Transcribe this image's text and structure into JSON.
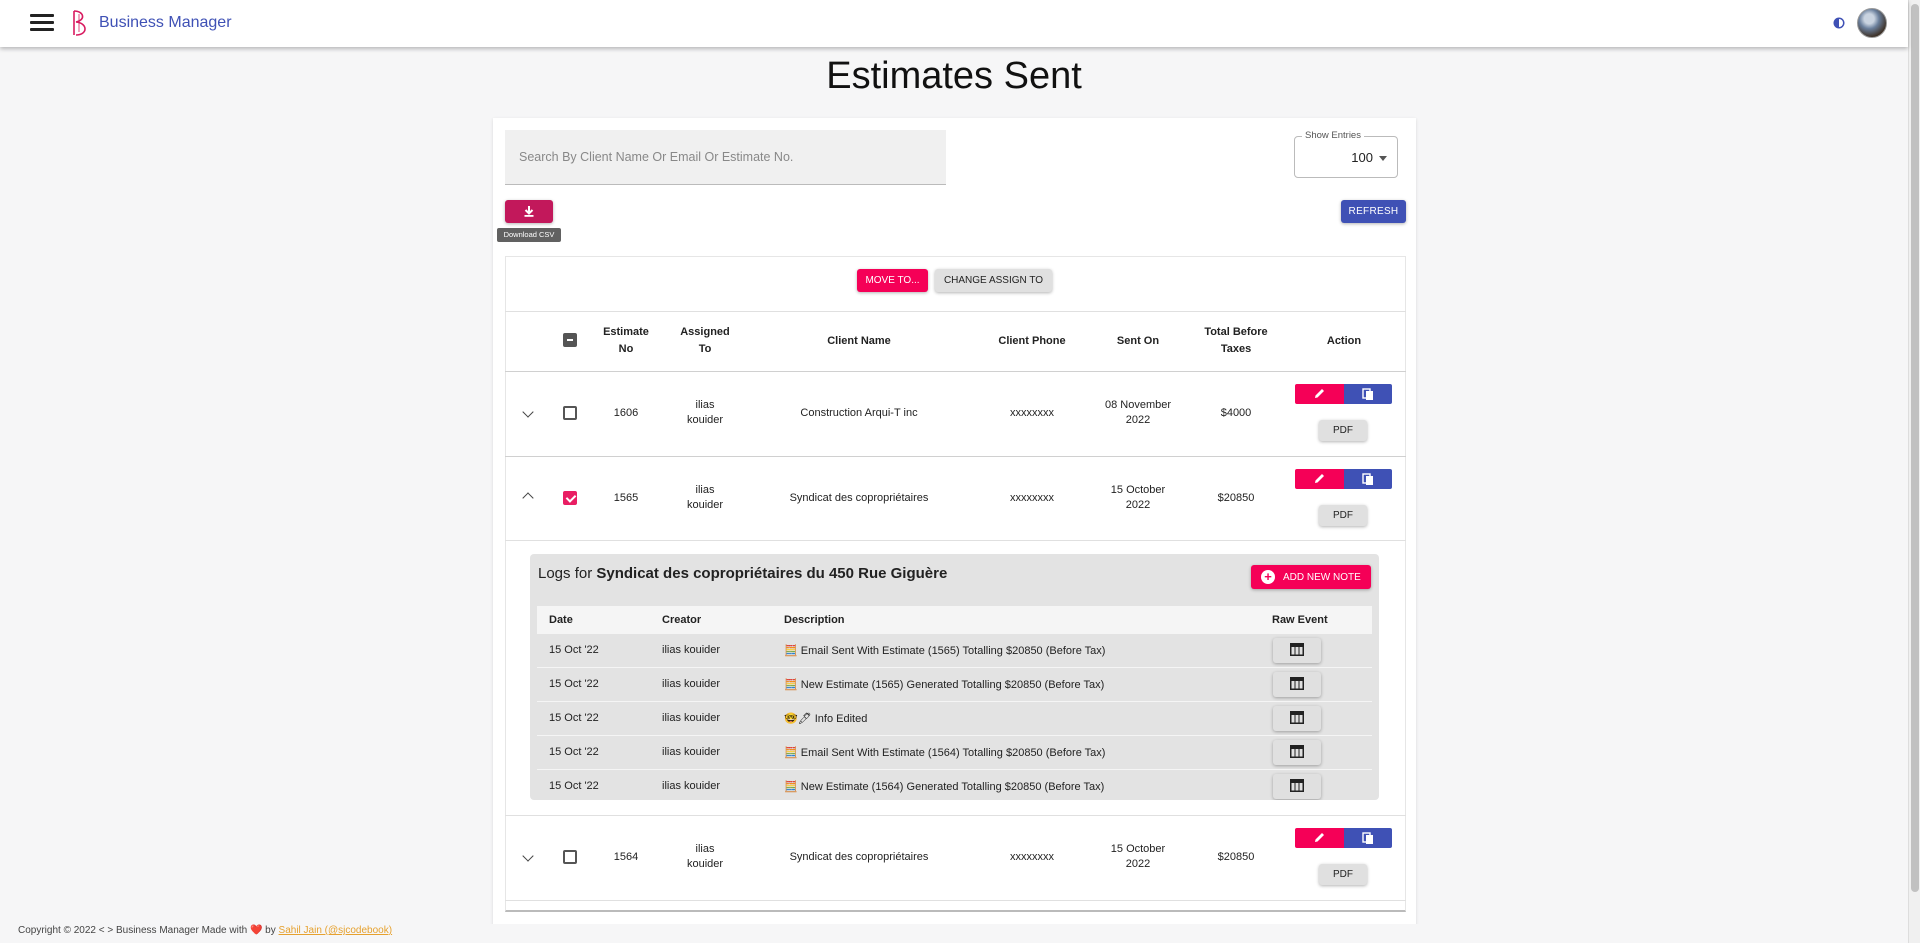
{
  "app": {
    "title": "Business Manager"
  },
  "page": {
    "title": "Estimates Sent"
  },
  "search": {
    "placeholder": "Search By Client Name Or Email Or Estimate No.",
    "value": ""
  },
  "entries": {
    "label": "Show Entries",
    "value": "100"
  },
  "toolbar": {
    "download_tooltip": "Download CSV",
    "refresh_label": "REFRESH",
    "move_label": "MOVE TO...",
    "assign_label": "CHANGE ASSIGN TO"
  },
  "table": {
    "headers": {
      "estimate_no_1": "Estimate",
      "estimate_no_2": "No",
      "assigned_1": "Assigned",
      "assigned_2": "To",
      "client_name": "Client Name",
      "client_phone": "Client Phone",
      "sent_on": "Sent On",
      "total_1": "Total Before",
      "total_2": "Taxes",
      "action": "Action"
    },
    "rows": [
      {
        "estimate_no": "1606",
        "assigned_1": "ilias",
        "assigned_2": "kouider",
        "client_name": "Construction Arqui-T inc",
        "phone": "xxxxxxxx",
        "sent_1": "08 November",
        "sent_2": "2022",
        "total": "$4000",
        "pdf": "PDF",
        "checked": false
      },
      {
        "estimate_no": "1565",
        "assigned_1": "ilias",
        "assigned_2": "kouider",
        "client_name": "Syndicat des copropriétaires",
        "phone": "xxxxxxxx",
        "sent_1": "15 October",
        "sent_2": "2022",
        "total": "$20850",
        "pdf": "PDF",
        "checked": true
      },
      {
        "estimate_no": "1564",
        "assigned_1": "ilias",
        "assigned_2": "kouider",
        "client_name": "Syndicat des copropriétaires",
        "phone": "xxxxxxxx",
        "sent_1": "15 October",
        "sent_2": "2022",
        "total": "$20850",
        "pdf": "PDF",
        "checked": false
      }
    ]
  },
  "logs": {
    "title_prefix": "Logs for ",
    "title_client": "Syndicat des copropriétaires du 450 Rue Giguère",
    "add_note_label": "ADD NEW NOTE",
    "headers": {
      "date": "Date",
      "creator": "Creator",
      "description": "Description",
      "raw": "Raw Event"
    },
    "rows": [
      {
        "date": "15 Oct '22",
        "creator": "ilias kouider",
        "description": "🧮 Email Sent With Estimate (1565) Totalling $20850 (Before Tax)"
      },
      {
        "date": "15 Oct '22",
        "creator": "ilias kouider",
        "description": "🧮 New Estimate (1565) Generated Totalling $20850 (Before Tax)"
      },
      {
        "date": "15 Oct '22",
        "creator": "ilias kouider",
        "description": "🤓🖊 Info Edited"
      },
      {
        "date": "15 Oct '22",
        "creator": "ilias kouider",
        "description": "🧮 Email Sent With Estimate (1564) Totalling $20850 (Before Tax)"
      },
      {
        "date": "15 Oct '22",
        "creator": "ilias kouider",
        "description": "🧮 New Estimate (1564) Generated Totalling $20850 (Before Tax)"
      }
    ]
  },
  "footer": {
    "copyright": "Copyright © 2022  < >  Business Manager Made with",
    "heart": "❤️",
    "by": " by ",
    "author": "Sahil Jain (@sjcodebook)"
  },
  "colors": {
    "primary": "#3f51b5",
    "secondary": "#f50057",
    "download": "#c2185b"
  }
}
